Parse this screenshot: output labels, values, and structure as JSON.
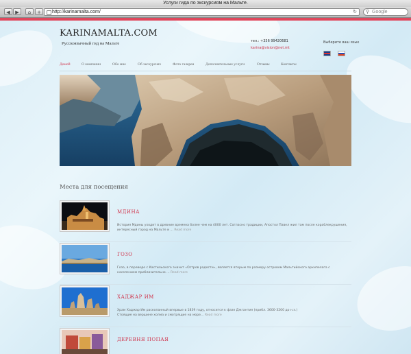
{
  "browser": {
    "window_title": "Услуги гида по экскурсиям на Мальте.",
    "back_icon": "back-arrow-icon",
    "forward_icon": "forward-arrow-icon",
    "home_icon": "home-icon",
    "add_icon": "plus-icon",
    "url": "http://karinamalta.com/",
    "reload_icon": "reload-icon",
    "search_placeholder": "Google",
    "search_icon": "magnifier-icon"
  },
  "site": {
    "logo_title": "KARINAMALTA.COM",
    "logo_subtitle": "Русскоязычный гид на Мальте",
    "phone": "тел.: +356 99420681",
    "email": "karina@vision@net.mt",
    "language_label": "Выберите ваш язык",
    "accent_color": "#d0334a"
  },
  "nav": {
    "items": [
      {
        "label": "Домой",
        "active": true
      },
      {
        "label": "О компании",
        "active": false
      },
      {
        "label": "Обо мне",
        "active": false
      },
      {
        "label": "Об экскурсиях",
        "active": false
      },
      {
        "label": "Фото галерея",
        "active": false
      },
      {
        "label": "Дополнительные услуги",
        "active": false
      },
      {
        "label": "Отзывы",
        "active": false
      },
      {
        "label": "Контакты",
        "active": false
      }
    ]
  },
  "main": {
    "section_title": "Места для посещения",
    "places": [
      {
        "title": "МДИНА",
        "description": "История Мдины уходит в древние времена более чем на 4000 лет. Согласно традиции, Апостол Павел жил там после кораблекрушения,",
        "description_2": "интересный город на Мальте и ...",
        "more": "Read more"
      },
      {
        "title": "ГОЗО",
        "description": "Гозо, в переводе с Кастильского значит «Остров радости», является вторым по размеру островом Мальтийского архипелага с",
        "description_2": "населением приблизительно ...",
        "more": "Read more"
      },
      {
        "title": "ХАДЖАР ИМ",
        "description": "Храм Хаджар Им раскопанный впервые в 1839 году, относится к фазе Джгантия (прибл. 3600-3200 до н.э.)",
        "description_2": "Стоящие на вершине холма и смотрящие на море...",
        "more": "Read more"
      },
      {
        "title": "ДЕРЕВНЯ ПОПАЯ",
        "description": "",
        "description_2": "",
        "more": ""
      }
    ]
  }
}
